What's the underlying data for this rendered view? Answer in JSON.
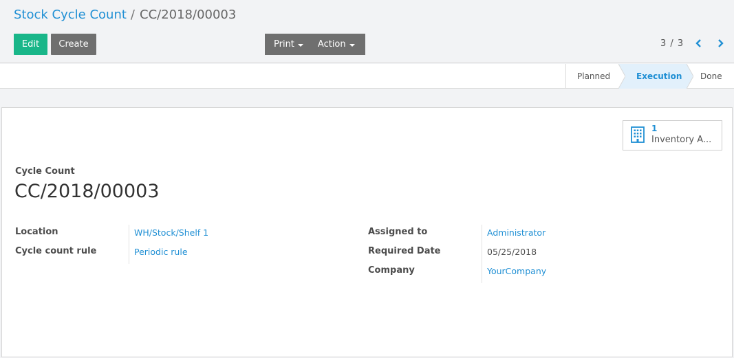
{
  "breadcrumb": {
    "parent": "Stock Cycle Count",
    "separator": "/",
    "current": "CC/2018/00003"
  },
  "buttons": {
    "edit": "Edit",
    "create": "Create",
    "print": "Print",
    "action": "Action"
  },
  "pager": {
    "value": "3 / 3"
  },
  "status": {
    "stages": [
      "Planned",
      "Execution",
      "Done"
    ],
    "active": "Execution"
  },
  "smart_button": {
    "count": "1",
    "label": "Inventory A..."
  },
  "form": {
    "title_label": "Cycle Count",
    "name": "CC/2018/00003",
    "left_fields": [
      {
        "label": "Location",
        "value": "WH/Stock/Shelf 1"
      },
      {
        "label": "Cycle count rule",
        "value": "Periodic rule"
      }
    ],
    "right_fields": [
      {
        "label": "Assigned to",
        "value": "Administrator"
      },
      {
        "label": "Required Date",
        "value": "05/25/2018"
      },
      {
        "label": "Company",
        "value": "YourCompany"
      }
    ]
  },
  "colors": {
    "accent": "#1f8fd4",
    "primary_button": "#19b689",
    "secondary_button": "#6f6f6f"
  }
}
